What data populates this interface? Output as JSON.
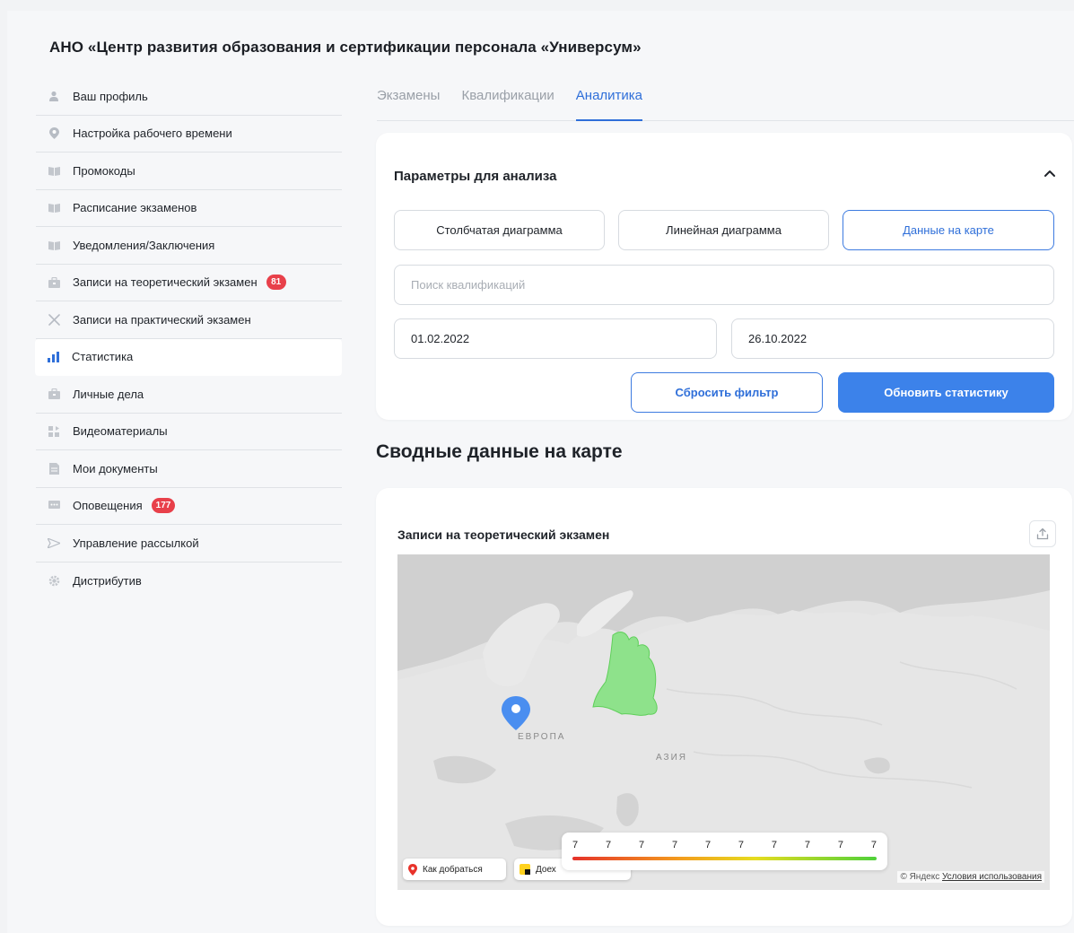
{
  "org_title": "АНО «Центр развития образования и сертификации персонала «Универсум»",
  "sidebar": {
    "items": [
      {
        "label": "Ваш профиль",
        "icon": "user-icon"
      },
      {
        "label": "Настройка рабочего времени",
        "icon": "location-pin-icon"
      },
      {
        "label": "Промокоды",
        "icon": "book-icon"
      },
      {
        "label": "Расписание экзаменов",
        "icon": "book-icon"
      },
      {
        "label": "Уведомления/Заключения",
        "icon": "book-icon"
      },
      {
        "label": "Записи на теоретический экзамен",
        "icon": "briefcase-icon",
        "badge": "81"
      },
      {
        "label": "Записи на практический экзамен",
        "icon": "tools-icon"
      },
      {
        "label": "Статистика",
        "icon": "bar-chart-icon",
        "active": true
      },
      {
        "label": "Личные дела",
        "icon": "briefcase-icon"
      },
      {
        "label": "Видеоматериалы",
        "icon": "video-icon"
      },
      {
        "label": "Мои документы",
        "icon": "document-icon"
      },
      {
        "label": "Оповещения",
        "icon": "chat-icon",
        "badge": "177"
      },
      {
        "label": "Управление рассылкой",
        "icon": "send-icon"
      },
      {
        "label": "Дистрибутив",
        "icon": "gear-icon"
      }
    ]
  },
  "tabs": [
    {
      "label": "Экзамены"
    },
    {
      "label": "Квалификации"
    },
    {
      "label": "Аналитика",
      "active": true
    }
  ],
  "params": {
    "title": "Параметры для анализа",
    "chart_buttons": [
      "Столбчатая диаграмма",
      "Линейная диаграмма",
      "Данные на карте"
    ],
    "search_placeholder": "Поиск квалификаций",
    "date_from": "01.02.2022",
    "date_to": "26.10.2022",
    "reset_label": "Сбросить фильтр",
    "update_label": "Обновить статистику"
  },
  "section_title": "Сводные данные на карте",
  "map_card": {
    "title": "Записи на теоретический экзамен",
    "labels": {
      "europe": "ЕВРОПА",
      "asia": "АЗИЯ"
    },
    "legend_values": [
      "7",
      "7",
      "7",
      "7",
      "7",
      "7",
      "7",
      "7",
      "7",
      "7"
    ],
    "route_button": "Как добраться",
    "taxi_button": "Доех",
    "copyright": "© Яндекс",
    "terms": "Условия использования"
  },
  "colors": {
    "accent": "#3c82ea",
    "badge": "#e8404a",
    "region": "#7ee07a"
  }
}
